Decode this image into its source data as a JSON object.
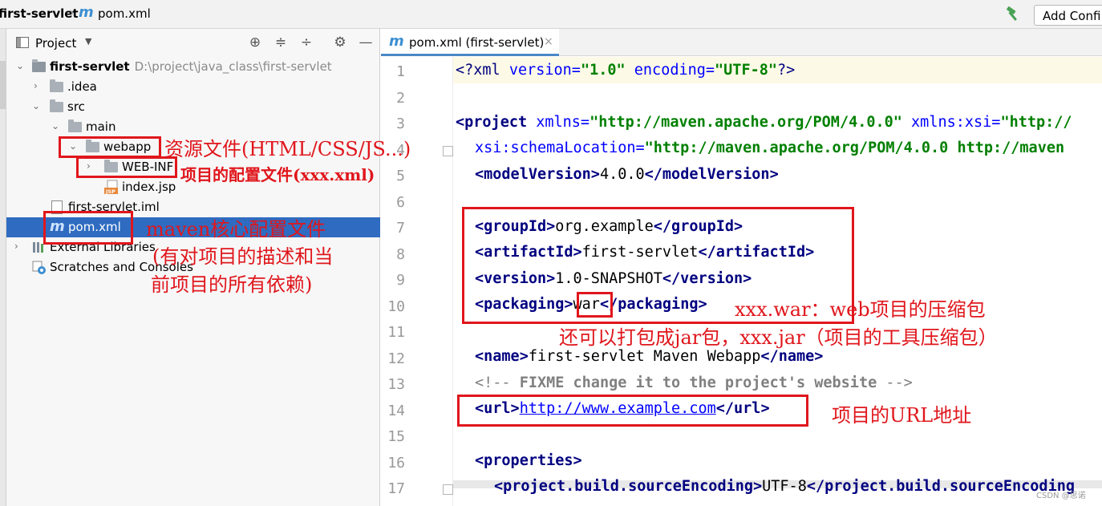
{
  "breadcrumb": {
    "project": "first-servlet",
    "file": "pom.xml",
    "m_glyph": "m"
  },
  "toolbar": {
    "add_config_label": "Add Confi",
    "build_icon": "hammer-icon"
  },
  "project_panel": {
    "title": "Project",
    "tree": {
      "root_label": "first-servlet",
      "root_path": "D:\\project\\java_class\\first-servlet",
      "idea": ".idea",
      "src": "src",
      "main": "main",
      "webapp": "webapp",
      "webinf": "WEB-INF",
      "index_jsp": "index.jsp",
      "iml": "first-servlet.iml",
      "pom": "pom.xml",
      "ext_libs": "External Libraries",
      "scratches": "Scratches and Consoles"
    }
  },
  "editor": {
    "tab_label": "pom.xml (first-servlet)",
    "tab_close": "×",
    "line_numbers": [
      "1",
      "2",
      "3",
      "4",
      "5",
      "6",
      "7",
      "8",
      "9",
      "10",
      "11",
      "12",
      "13",
      "14",
      "15",
      "16",
      "17"
    ],
    "code": {
      "l1_decl_open": "<?xml ",
      "l1_a1": "version=",
      "l1_v1": "\"1.0\"",
      "l1_a2": " encoding=",
      "l1_v2": "\"UTF-8\"",
      "l1_decl_close": "?>",
      "l3_tag": "<project",
      "l3_a1": " xmlns=",
      "l3_v1": "\"http://maven.apache.org/POM/4.0.0\"",
      "l3_a2": " xmlns:xsi=",
      "l3_v2": "\"http://",
      "l4_a": "xsi:schemaLocation=",
      "l4_v": "\"http://maven.apache.org/POM/4.0.0 http://maven",
      "l5_open": "<modelVersion>",
      "l5_val": "4.0.0",
      "l5_close": "</modelVersion>",
      "l7_open": "<groupId>",
      "l7_val": "org.example",
      "l7_close": "</groupId>",
      "l8_open": "<artifactId>",
      "l8_val": "first-servlet",
      "l8_close": "</artifactId>",
      "l9_open": "<version>",
      "l9_val": "1.0-SNAPSHOT",
      "l9_close": "</version>",
      "l10_open": "<packaging>",
      "l10_val": "war",
      "l10_close": "</packaging>",
      "l12_open": "<name>",
      "l12_val": "first-servlet Maven Webapp",
      "l12_close": "</name>",
      "l13_a": "<!-- ",
      "l13_b": "FIXME change it to the project's website",
      "l13_c": " -->",
      "l14_open": "<url>",
      "l14_val": "http://www.example.com",
      "l14_close": "</url>",
      "l16_open": "<properties>",
      "l17_open": "<project.build.sourceEncoding>",
      "l17_val": "UTF-8",
      "l17_close": "</project.build.sourceEncoding"
    }
  },
  "annotations": {
    "webapp_note": "资源文件(HTML/CSS/JS...)",
    "webinf_note": "项目的配置文件(xxx.xml)",
    "pom_note_1": "maven核心配置文件",
    "pom_note_2": "(有对项目的描述和当",
    "pom_note_3": "前项目的所有依赖)",
    "war_note": "xxx.war：web项目的压缩包",
    "jar_note": "还可以打包成jar包，xxx.jar（项目的工具压缩包）",
    "url_note": "项目的URL地址"
  },
  "watermark": "CSDN @思诺",
  "colors": {
    "annotation_red": "#e0161c",
    "selection_blue": "#2f6cc1",
    "xml_tag": "#000080",
    "xml_attr": "#0000ff",
    "xml_value": "#008000"
  }
}
